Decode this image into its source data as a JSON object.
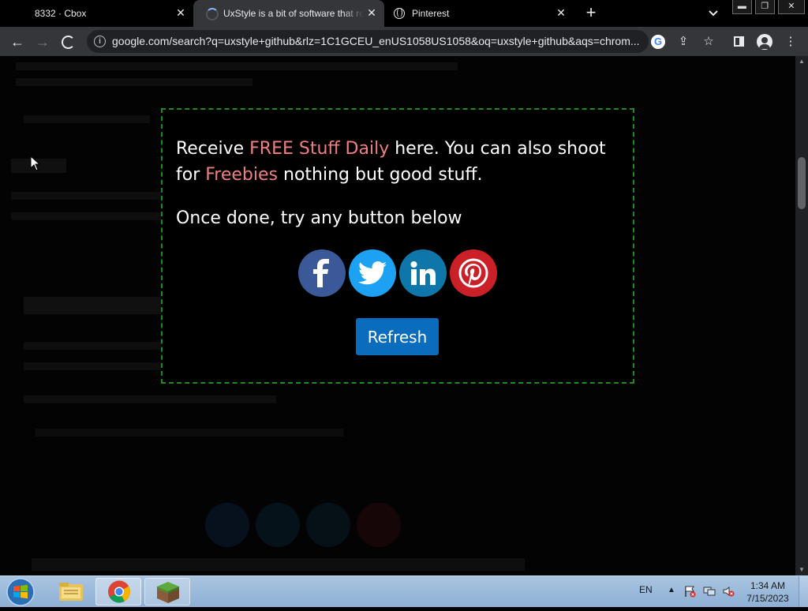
{
  "browser": {
    "tabs": [
      {
        "title": "8332 · Cbox",
        "close_glyph": "✕"
      },
      {
        "title": "UxStyle is a bit of software that re",
        "close_glyph": "✕"
      },
      {
        "title": "Pinterest",
        "close_glyph": "✕"
      }
    ],
    "new_tab_glyph": "+",
    "tab_search_glyph": "⌄",
    "window_controls": {
      "minimize": "▬",
      "maximize": "❐",
      "close": "✕"
    },
    "toolbar": {
      "back_glyph": "←",
      "forward_glyph": "→",
      "url": "google.com/search?q=uxstyle+github&rlz=1C1GCEU_enUS1058US1058&oq=uxstyle+github&aqs=chrom...",
      "google_glyph": "G",
      "share_glyph": "⇪",
      "bookmark_glyph": "☆",
      "menu_glyph": "⋮"
    }
  },
  "modal": {
    "line1_prefix": "Receive ",
    "line1_link": "FREE Stuff Daily",
    "line1_suffix": " here. You can also shoot for ",
    "line2_link": "Freebies",
    "line2_suffix": " nothing but good stuff.",
    "subtitle": "Once done, try any button below",
    "social_buttons": [
      "facebook",
      "twitter",
      "linkedin",
      "pinterest"
    ],
    "refresh_label": "Refresh",
    "accent_color": "#f08080",
    "border_color": "#1f8c1f"
  },
  "taskbar": {
    "language": "EN",
    "tray_arrow": "▲",
    "time": "1:34 AM",
    "date": "7/15/2023"
  }
}
